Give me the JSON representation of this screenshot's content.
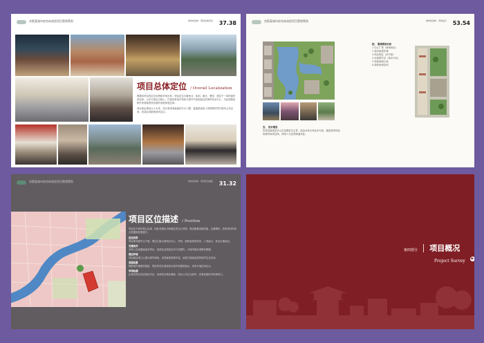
{
  "pages": [
    {
      "page_number": "37.38",
      "header_text": "合肥某城市综合体改造项目营销策划",
      "sub_header": "城市综合体 · 项目总体定位",
      "title_cn": "项目总体定位",
      "title_en": "/ Overall Localization",
      "body_text": "根据本项目的区位优势和市场分析，项目定位为集商业、休闲、娱乐、餐饮、居住于一体的城市综合体。以步行街区为核心，打造具有地方特色与现代气息相结合的城市商业中心，为区域居民和外来游客提供全新的消费体验空间。",
      "body_text_2": "商业街区规划以人为本，充分考虑消费者的行为习惯，营造舒适宜人的购物环境与城市公共空间，形成区域新的城市名片。"
    },
    {
      "page_number": "53.54",
      "header_text": "合肥某城市综合体改造项目营销策划",
      "sub_header": "城市综合体 · 景观设计",
      "section1_title": "四、 景观规划分析",
      "section1_items": [
        "1.中心广场（休闲商业）",
        "2.滨水景观步道",
        "3.商业街区（步行街）",
        "4.水景观节点（亲水平台）",
        "5.特色景观小品",
        "6.绿化休闲空间"
      ],
      "section2_title": "五、 设计理念",
      "section2_text": "本项目景观设计以生态理念为主导，结合水系与商业步行街，营造具有特色的城市休闲空间，体现人与自然和谐共处。"
    },
    {
      "page_number": "31.32",
      "header_text": "合肥某城市综合体改造项目营销策划",
      "sub_header": "城市综合体 · 项目区位描述",
      "title_cn": "项目区位描述",
      "title_en": "/ Position",
      "intro": "项目位于城市核心区域，地处老城区与新城区的交汇地带，周边配套设施完善，交通便利，具有良好的商业氛围和发展潜力。",
      "blocks": [
        {
          "heading": "区位优势",
          "text": "项目紧邻城市主干道，周边汇聚大型商业中心、学校、医院及政府机关，人流量大，商业价值突出。"
        },
        {
          "heading": "交通条件",
          "text": "多条公交线路途经本项目，地铁站点规划在步行范围内，与城市各区域联系便捷。"
        },
        {
          "heading": "周边环境",
          "text": "项目临近滨江公园与城市绿地，自然景观资源丰富，适宜打造高品质的城市生活空间。"
        },
        {
          "heading": "发展前景",
          "text": "随着城市更新的推进，项目所在区域将成为城市发展的重点，未来升值空间巨大。"
        },
        {
          "heading": "市场机遇",
          "text": "区域内商业供应相对不足，优质商业物业稀缺，项目入市正当其时，具有较强的市场竞争力。"
        }
      ]
    },
    {
      "section_number": "第四部分",
      "title_cn": "项目概况",
      "title_en": "Project Survey"
    }
  ],
  "colors": {
    "background": "#6e5a9e",
    "page1_bg": "#ffffff",
    "page2_bg": "#fbfaf6",
    "page3_bg": "#605c5f",
    "page4_bg": "#7f1e24",
    "accent_red": "#8a1e24",
    "map_river": "#4f88c4",
    "map_highlight": "#d23a32"
  },
  "icons": [
    "logo-icon",
    "arrow-right-icon"
  ]
}
